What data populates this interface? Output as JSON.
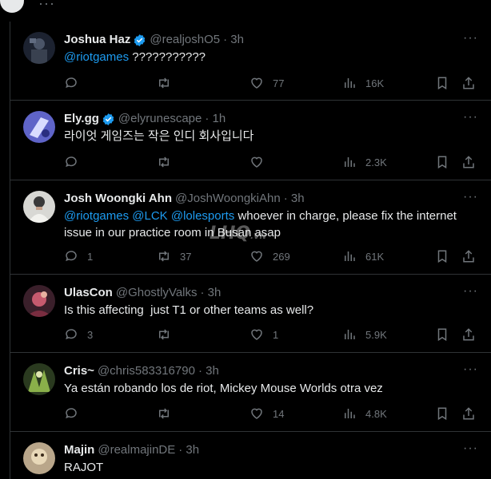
{
  "tweets": [
    {
      "name": "Joshua Haz",
      "verified": true,
      "handle": "@realjoshO5",
      "time": "· 3h",
      "text_parts": [
        {
          "text": "@riotgames",
          "mention": true
        },
        {
          "text": " ???????????",
          "mention": false
        }
      ],
      "replies": "",
      "retweets": "",
      "likes": "77",
      "views": "16K"
    },
    {
      "name": "Ely.gg",
      "verified": true,
      "handle": "@elyrunescape",
      "time": "· 1h",
      "text_parts": [
        {
          "text": "라이엇 게임즈는 작은 인디 회사입니다",
          "mention": false
        }
      ],
      "replies": "",
      "retweets": "",
      "likes": "",
      "views": "2.3K"
    },
    {
      "name": "Josh Woongki Ahn",
      "verified": false,
      "handle": "@JoshWoongkiAhn",
      "time": "· 3h",
      "text_parts": [
        {
          "text": "@riotgames",
          "mention": true
        },
        {
          "text": " ",
          "mention": false
        },
        {
          "text": "@LCK",
          "mention": true
        },
        {
          "text": " ",
          "mention": false
        },
        {
          "text": "@lolesports",
          "mention": true
        },
        {
          "text": " whoever in charge, please fix the internet issue in our practice room in Busan asap",
          "mention": false
        }
      ],
      "replies": "1",
      "retweets": "37",
      "likes": "269",
      "views": "61K"
    },
    {
      "name": "UlasCon",
      "verified": false,
      "handle": "@GhostlyValks",
      "time": "· 3h",
      "text_parts": [
        {
          "text": "Is this affecting  just T1 or other teams as well?",
          "mention": false
        }
      ],
      "replies": "3",
      "retweets": "",
      "likes": "1",
      "views": "5.9K"
    },
    {
      "name": "Cris~",
      "verified": false,
      "handle": "@chris583316790",
      "time": "· 3h",
      "text_parts": [
        {
          "text": "Ya están robando los de riot, Mickey Mouse Worlds otra vez",
          "mention": false
        }
      ],
      "replies": "",
      "retweets": "",
      "likes": "14",
      "views": "4.8K"
    },
    {
      "name": "Majin",
      "verified": false,
      "handle": "@realmajinDE",
      "time": "· 3h",
      "text_parts": [
        {
          "text": "RAJOT",
          "mention": false
        }
      ],
      "replies": "",
      "retweets": "",
      "likes": "",
      "views": ""
    }
  ],
  "watermark": "LHQ.VN",
  "colors": {
    "background": "#000000",
    "text": "#e7e9ea",
    "muted": "#71767b",
    "accent": "#1d9bf0",
    "divider": "#2f3336"
  },
  "icons": {
    "reply": "reply-icon",
    "retweet": "retweet-icon",
    "like": "heart-icon",
    "views": "views-icon",
    "bookmark": "bookmark-icon",
    "share": "share-icon",
    "more": "more-icon",
    "verified": "verified-badge-icon"
  }
}
